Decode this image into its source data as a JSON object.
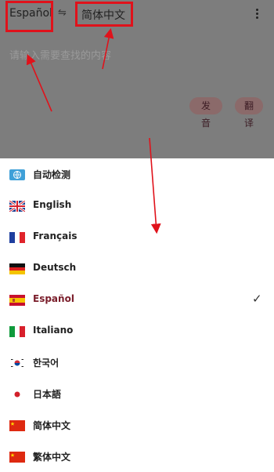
{
  "header": {
    "source_language": "Español",
    "swap_glyph": "⇋",
    "target_language": "简体中文"
  },
  "input": {
    "placeholder": "请输入需要查找的内容"
  },
  "actions": {
    "speak_label": "发音",
    "translate_label": "翻译"
  },
  "languages": [
    {
      "label": "自动检测",
      "icon": "globe-icon"
    },
    {
      "label": "English",
      "icon": "uk-flag-icon"
    },
    {
      "label": "Français",
      "icon": "france-flag-icon"
    },
    {
      "label": "Deutsch",
      "icon": "germany-flag-icon"
    },
    {
      "label": "Español",
      "icon": "spain-flag-icon",
      "selected": true
    },
    {
      "label": "Italiano",
      "icon": "italy-flag-icon"
    },
    {
      "label": "한국어",
      "icon": "korea-flag-icon"
    },
    {
      "label": "日本語",
      "icon": "japan-flag-icon"
    },
    {
      "label": "简体中文",
      "icon": "china-flag-icon"
    },
    {
      "label": "繁体中文",
      "icon": "china-flag-icon"
    }
  ],
  "check_glyph": "✓",
  "colors": {
    "overlay": "#7d7d7d",
    "annotation_red": "#e0121b",
    "selected_text": "#7a1d2a"
  }
}
